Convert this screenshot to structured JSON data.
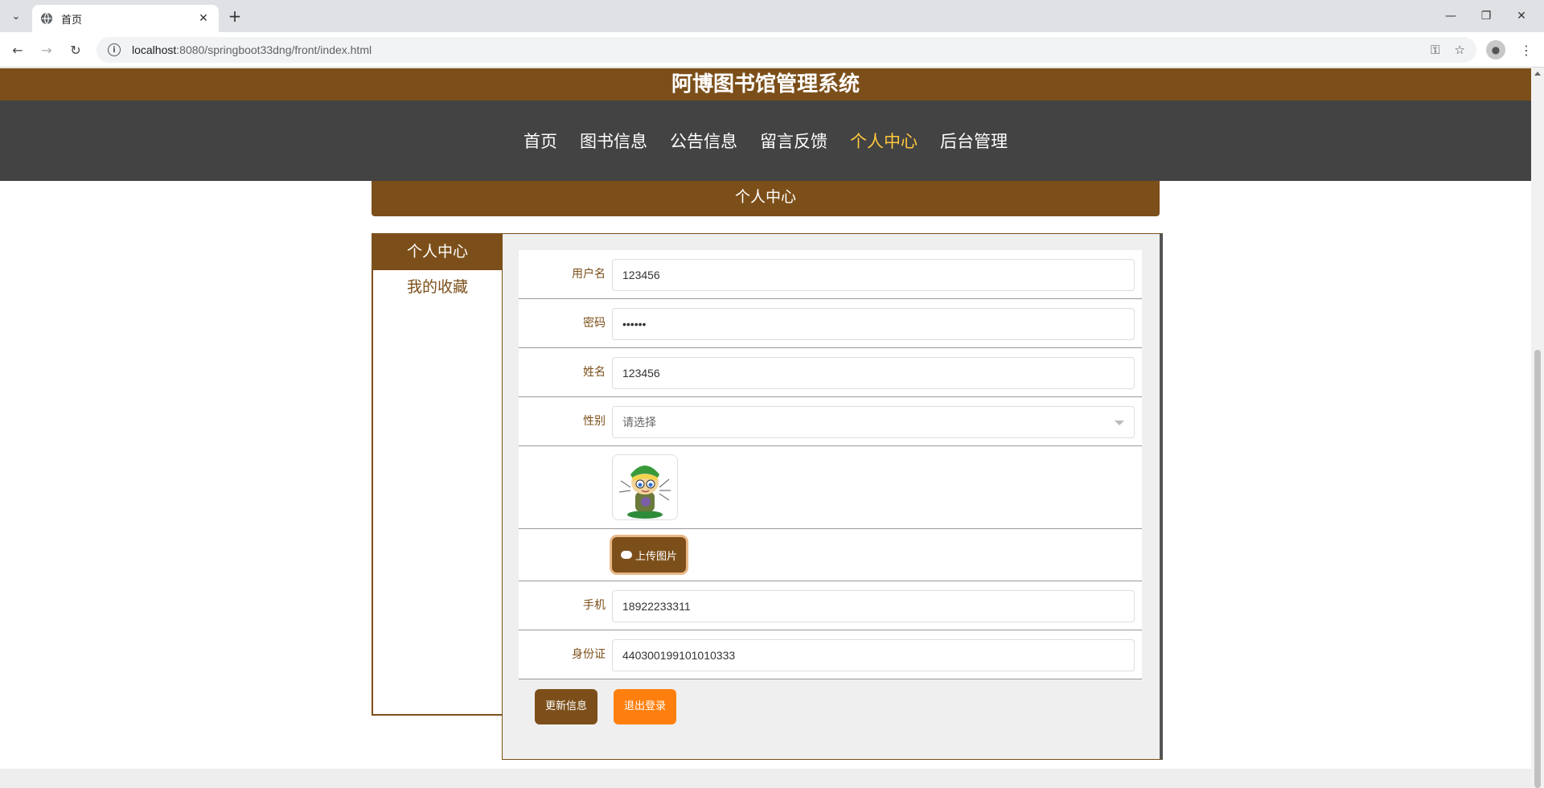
{
  "browser": {
    "tab_title": "首页",
    "url_host": "localhost",
    "url_path": ":8080/springboot33dng/front/index.html"
  },
  "site": {
    "title": "阿博图书馆管理系统",
    "nav": [
      {
        "label": "首页",
        "active": false
      },
      {
        "label": "图书信息",
        "active": false
      },
      {
        "label": "公告信息",
        "active": false
      },
      {
        "label": "留言反馈",
        "active": false
      },
      {
        "label": "个人中心",
        "active": true
      },
      {
        "label": "后台管理",
        "active": false
      }
    ]
  },
  "section_title": "个人中心",
  "sidemenu": [
    {
      "label": "个人中心",
      "active": true
    },
    {
      "label": "我的收藏",
      "active": false
    }
  ],
  "form": {
    "username_label": "用户名",
    "username_value": "123456",
    "password_label": "密码",
    "password_value": "••••••",
    "name_label": "姓名",
    "name_value": "123456",
    "gender_label": "性别",
    "gender_value": "请选择",
    "upload_label": "上传图片",
    "phone_label": "手机",
    "phone_value": "18922233311",
    "idcard_label": "身份证",
    "idcard_value": "440300199101010333",
    "update_button": "更新信息",
    "logout_button": "退出登录"
  },
  "colors": {
    "brand_brown": "#7c4f1a",
    "nav_bg": "#434343",
    "active_nav": "#ffc83d",
    "logout_orange": "#ff7f0e"
  }
}
